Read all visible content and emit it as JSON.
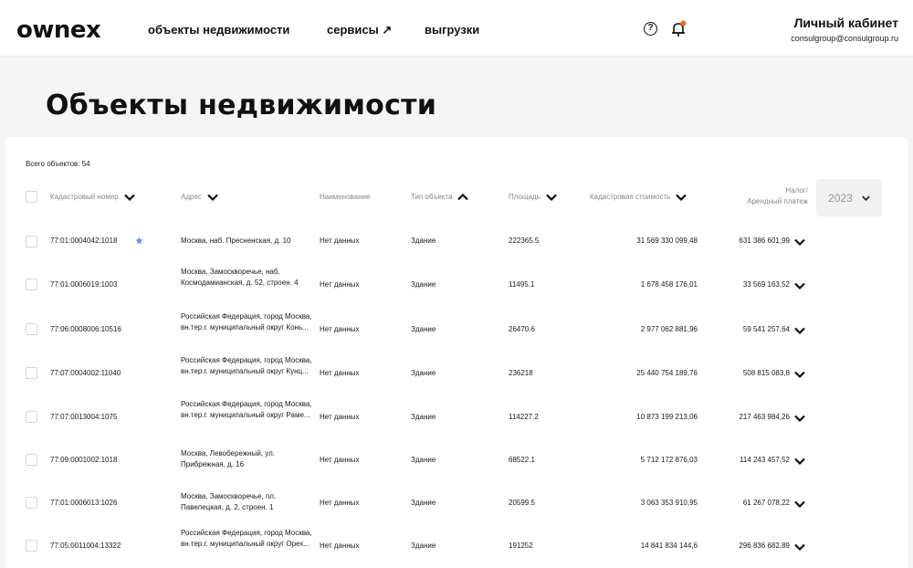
{
  "header": {
    "logo": "ownex",
    "nav": [
      "объекты недвижимости",
      "сервисы ↗",
      "выгрузки"
    ],
    "help_glyph": "?",
    "profile_title": "Личный кабинет",
    "profile_email": "consulgroup@consulgroup.ru",
    "notification_dot_color": "#f26522"
  },
  "page": {
    "title": "Объекты недвижимости",
    "total": "Всего объектов: 54"
  },
  "table": {
    "headers": {
      "cadastral": "Кадастровый номер",
      "address": "Адрес",
      "name": "Наименование",
      "type": "Тип объекта",
      "area": "Площадь",
      "cost": "Кадастровая стоимость",
      "tax_line1": "Налог/",
      "tax_line2": "Арендный платеж"
    },
    "year": "2023",
    "rows": [
      {
        "cad": "77:01:0004042:1018",
        "addr": "Москва, наб. Пресненская, д. 10",
        "name": "Нет данных",
        "type": "Здание",
        "area": "222365.5",
        "cost": "31 569 330 099,48",
        "tax": "631 386 601,99",
        "starred": true
      },
      {
        "cad": "77:01:0006019:1003",
        "addr": "Москва, Замоскворечье, наб. Космодамианская, д. 52, строен. 4",
        "name": "Нет данных",
        "type": "Здание",
        "area": "11495.1",
        "cost": "1 678 458 176,01",
        "tax": "33 569 163,52"
      },
      {
        "cad": "77:06:0008006:10516",
        "addr": "Российская Федерация, город Москва, вн.тер.г. муниципальный округ Конь...",
        "name": "Нет данных",
        "type": "Здание",
        "area": "26470.6",
        "cost": "2 977 062 881,96",
        "tax": "59 541 257,64"
      },
      {
        "cad": "77:07:0004002:11040",
        "addr": "Российская Федерация, город Москва, вн.тер.г. муниципальный округ Кунц...",
        "name": "Нет данных",
        "type": "Здание",
        "area": "236218",
        "cost": "25 440 754 189,76",
        "tax": "508 815 083,8"
      },
      {
        "cad": "77:07:0013004:1075",
        "addr": "Российская Федерация, город Москва, вн.тер.г. муниципальный округ Раме...",
        "name": "Нет данных",
        "type": "Здание",
        "area": "114227.2",
        "cost": "10 873 199 213,06",
        "tax": "217 463 984,26"
      },
      {
        "cad": "77:09:0001002:1018",
        "addr": "Москва, Левобережный, ул. Прибрежная, д. 16",
        "name": "Нет данных",
        "type": "Здание",
        "area": "68522.1",
        "cost": "5 712 172 876,03",
        "tax": "114 243 457,52"
      },
      {
        "cad": "77:01:0006013:1026",
        "addr": "Москва, Замоскворечье, пл. Павелецкая, д. 2, строен. 1",
        "name": "Нет данных",
        "type": "Здание",
        "area": "20599.5",
        "cost": "3 063 353 910,95",
        "tax": "61 267 078,22"
      },
      {
        "cad": "77:05:0011004:13322",
        "addr": "Российская Федерация, город Москва, вн.тер.г. муниципальный округ Орех...",
        "name": "Нет данных",
        "type": "Здание",
        "area": "191252",
        "cost": "14 841 834 144,6",
        "tax": "296 836 682,89"
      }
    ]
  },
  "colors": {
    "accent_star": "#6a8fd8",
    "text": "#1a1a1a",
    "muted": "#888888",
    "background": "#f5f5f5"
  }
}
